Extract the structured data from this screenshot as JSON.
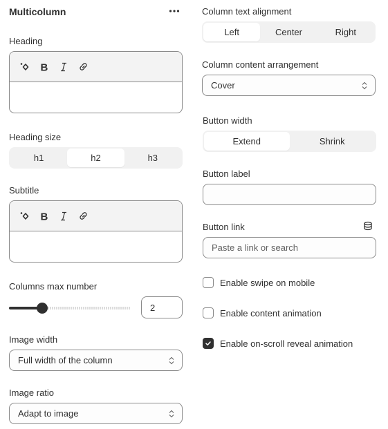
{
  "panel": {
    "title": "Multicolumn",
    "more_icon": "more-horizontal-icon"
  },
  "left": {
    "heading": {
      "label": "Heading",
      "value": "",
      "toolbar": [
        "magic-icon",
        "bold-icon",
        "italic-icon",
        "link-icon"
      ]
    },
    "heading_size": {
      "label": "Heading size",
      "options": [
        "h1",
        "h2",
        "h3"
      ],
      "selected": "h2"
    },
    "subtitle": {
      "label": "Subtitle",
      "value": "",
      "toolbar": [
        "magic-icon",
        "bold-icon",
        "italic-icon",
        "link-icon"
      ]
    },
    "columns_max": {
      "label": "Columns max number",
      "value": "2",
      "slider_fraction": 0.27
    },
    "image_width": {
      "label": "Image width",
      "value": "Full width of the column"
    },
    "image_ratio": {
      "label": "Image ratio",
      "value": "Adapt to image"
    }
  },
  "right": {
    "text_alignment": {
      "label": "Column text alignment",
      "options": [
        "Left",
        "Center",
        "Right"
      ],
      "selected": "Left"
    },
    "content_arrangement": {
      "label": "Column content arrangement",
      "value": "Cover"
    },
    "button_width": {
      "label": "Button width",
      "options": [
        "Extend",
        "Shrink"
      ],
      "selected": "Extend"
    },
    "button_label": {
      "label": "Button label",
      "value": ""
    },
    "button_link": {
      "label": "Button link",
      "placeholder": "Paste a link or search",
      "value": "",
      "icon": "database-icon"
    },
    "checkboxes": [
      {
        "label": "Enable swipe on mobile",
        "checked": false
      },
      {
        "label": "Enable content animation",
        "checked": false
      },
      {
        "label": "Enable on-scroll reveal animation",
        "checked": true
      }
    ]
  }
}
